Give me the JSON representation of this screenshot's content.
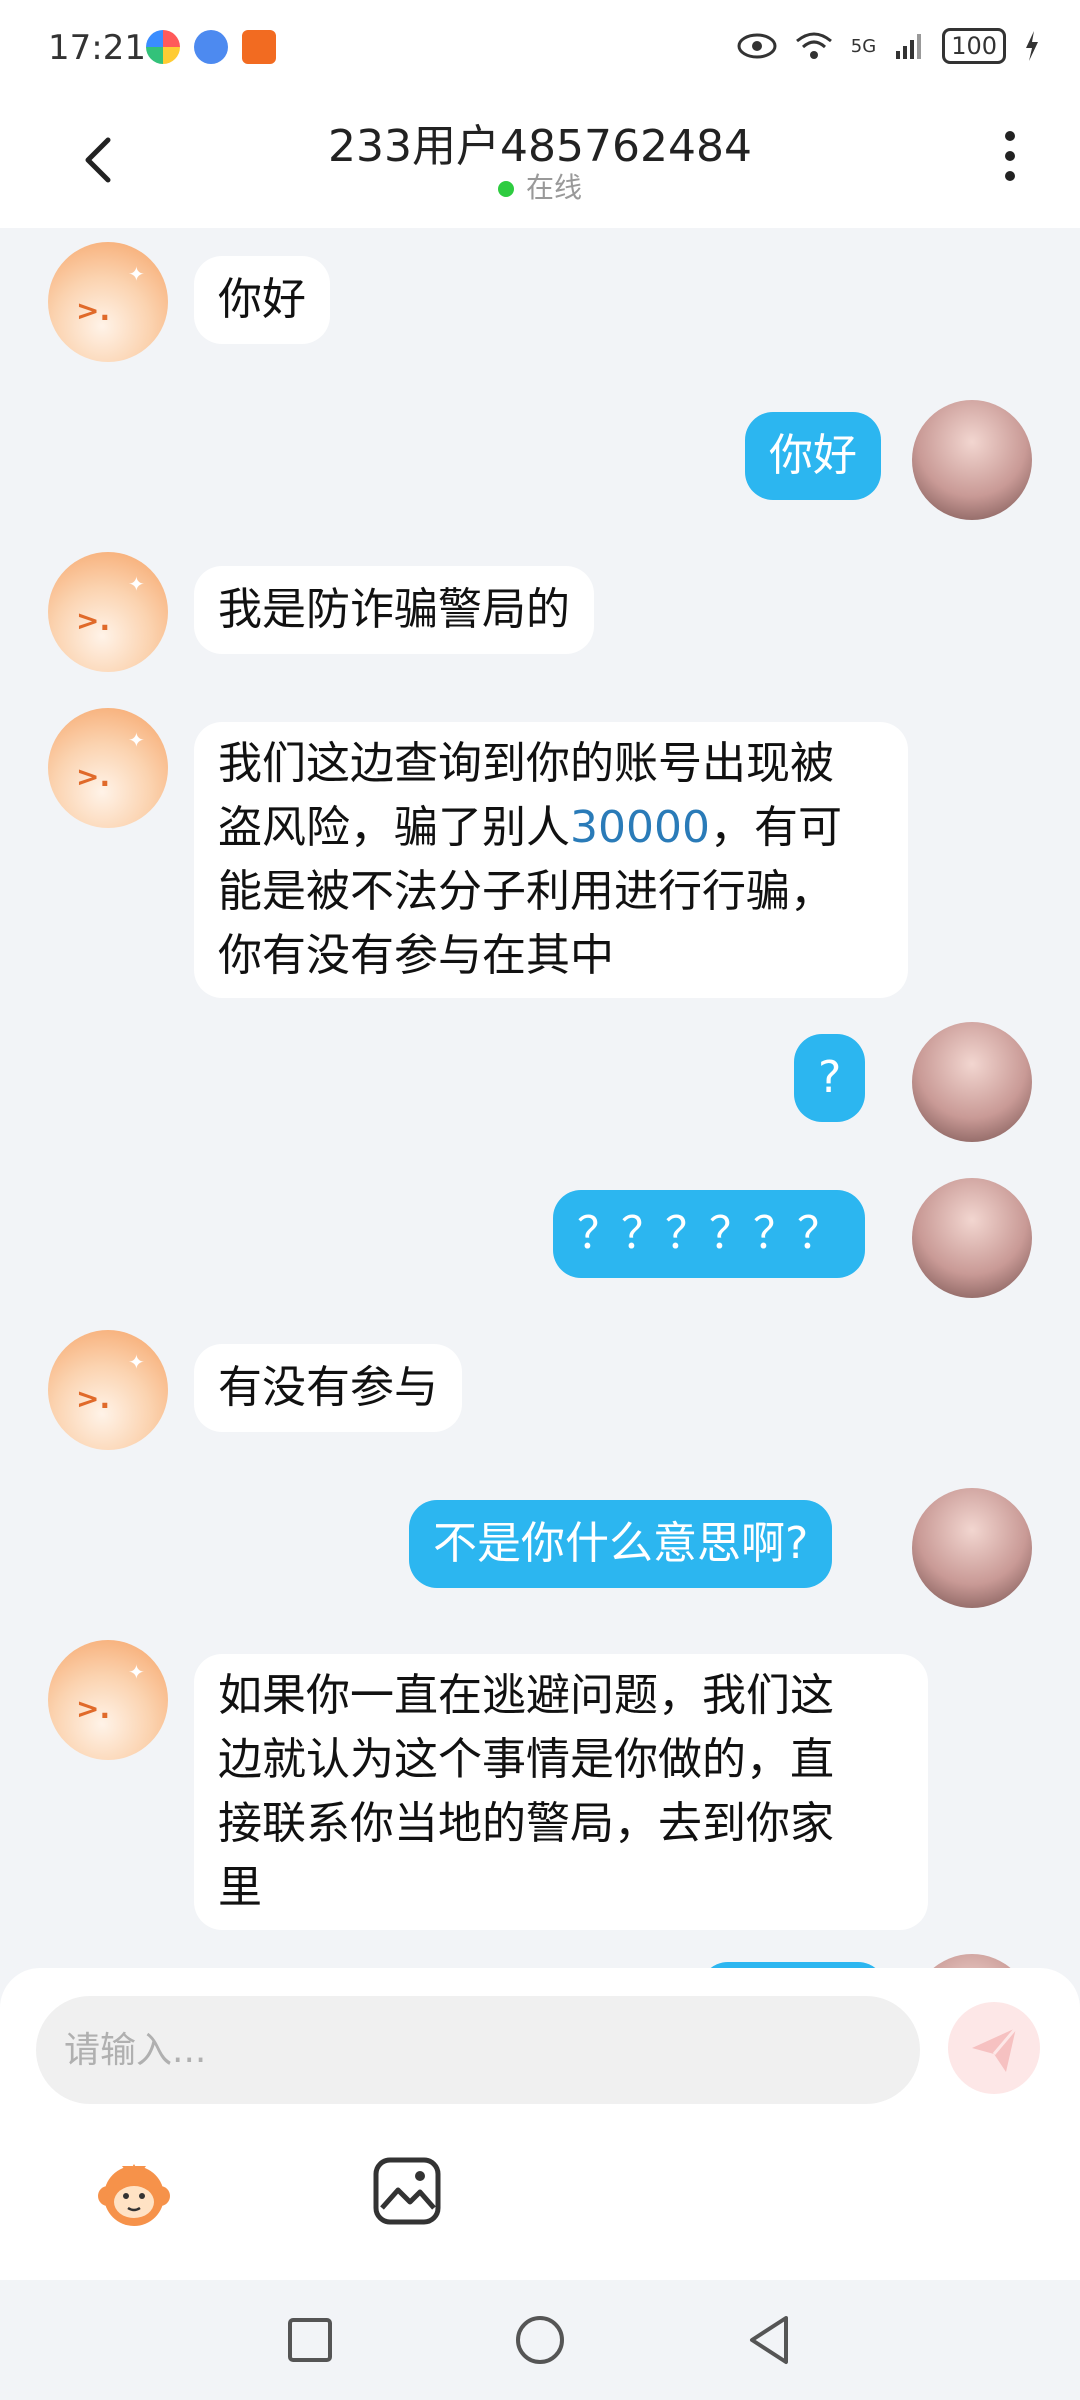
{
  "status_bar": {
    "time": "17:21",
    "network": "5G",
    "battery": "100"
  },
  "header": {
    "title": "233用户485762484",
    "online_status": "在线"
  },
  "messages": [
    {
      "side": "in",
      "text": "你好"
    },
    {
      "side": "out",
      "text": "你好"
    },
    {
      "side": "in",
      "text": "我是防诈骗警局的"
    },
    {
      "side": "in",
      "text_lines": [
        "我们这边查询到你的账号出现被",
        "盗风险，骗了别人",
        "30000",
        "，有可",
        "能是被不法分子利用进行行骗，",
        "你有没有参与在其中"
      ]
    },
    {
      "side": "out",
      "text": "?"
    },
    {
      "side": "out",
      "text": "？？？？？？"
    },
    {
      "side": "in",
      "text": "有没有参与"
    },
    {
      "side": "out",
      "text": "不是你什么意思啊?"
    },
    {
      "side": "in",
      "text_lines": [
        "如果你一直在逃避问题，我们这",
        "边就认为这个事情是你做的，直",
        "接联系你当地的警局，去到你家",
        "里"
      ]
    }
  ],
  "composer": {
    "placeholder": "请输入..."
  },
  "colors": {
    "outgoing_bubble": "#2cb6f0",
    "incoming_bubble": "#ffffff",
    "online_dot": "#2ecc40",
    "highlight_number": "#2a7bb8"
  },
  "icons": [
    "back-arrow-icon",
    "more-vertical-icon",
    "send-icon",
    "emoji-monkey-icon",
    "image-icon",
    "nav-recents-icon",
    "nav-home-icon",
    "nav-back-icon"
  ]
}
